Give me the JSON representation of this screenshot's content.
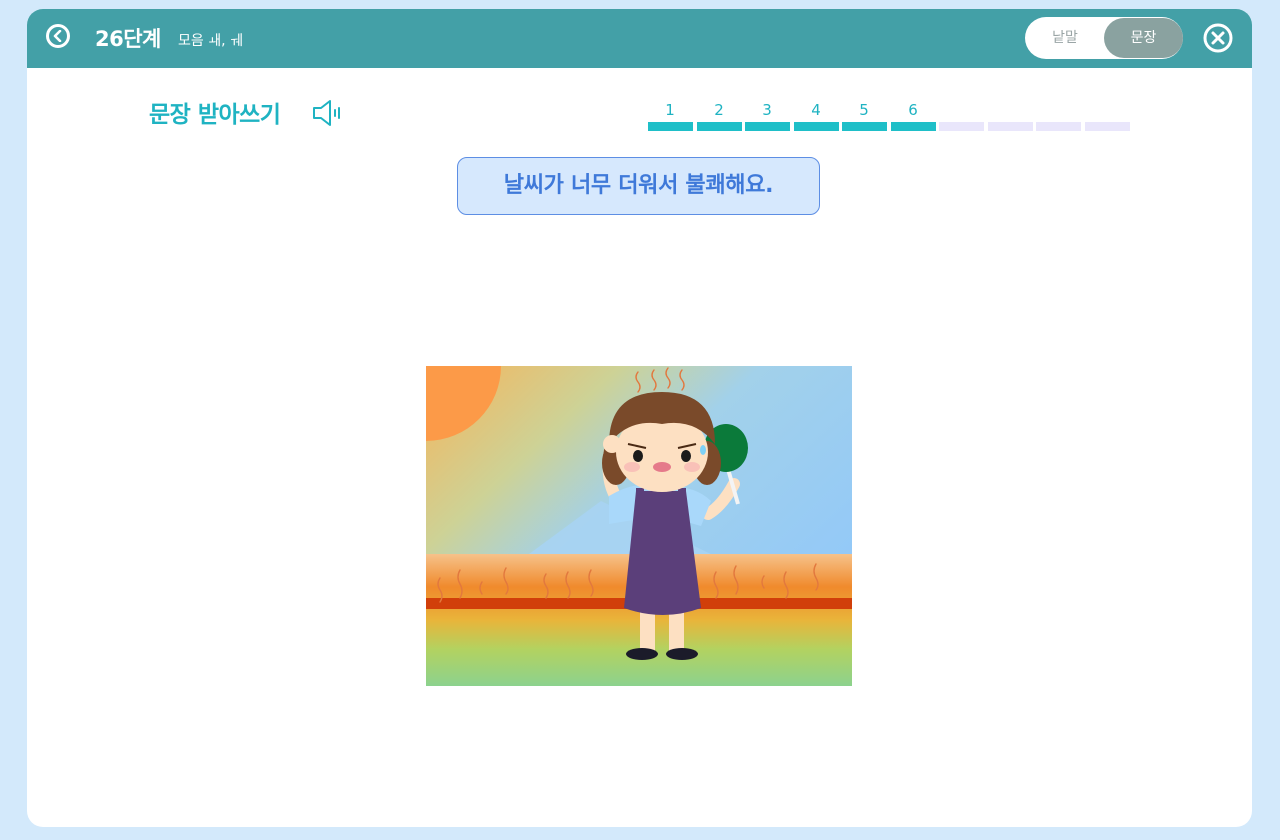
{
  "header": {
    "title": "26단계",
    "subtitle": "모음 ㅙ, ㅞ",
    "back_icon": "chevron-left-circle-icon",
    "close_icon": "close-circle-icon",
    "bg_color": "#43a0a7"
  },
  "mode_toggle": {
    "options": [
      "낱말",
      "문장"
    ],
    "selected": "문장"
  },
  "activity": {
    "title": "문장 받아쓰기",
    "speaker_icon": "speaker-icon",
    "accent_color": "#1fb3c2"
  },
  "progress": {
    "steps": [
      "1",
      "2",
      "3",
      "4",
      "5",
      "6",
      "",
      "",
      "",
      ""
    ],
    "completed": 6,
    "total": 10
  },
  "sentence": {
    "text": "날씨가 너무 더워서 불쾌해요."
  },
  "illustration": {
    "subject": "girl-fanning-in-heat-illustration"
  }
}
